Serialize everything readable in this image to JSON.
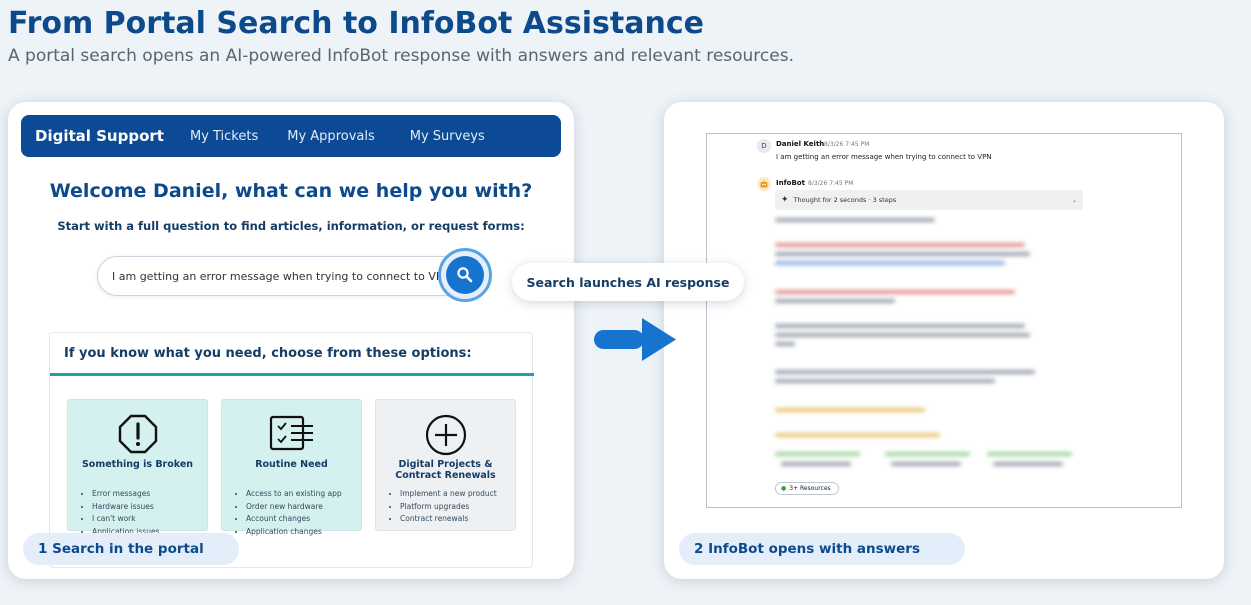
{
  "header": {
    "title": "From Portal Search to InfoBot Assistance",
    "subtitle": "A portal search opens an AI-powered InfoBot response with answers and relevant resources."
  },
  "portal": {
    "nav": {
      "brand": "Digital Support",
      "links": [
        "My Tickets",
        "My Approvals",
        "My Surveys"
      ]
    },
    "welcome": "Welcome Daniel, what can we help you with?",
    "prompt": "Start with a full question to find articles, information, or request forms:",
    "search": {
      "value": "I am getting an error message when trying to connect to VPN",
      "button_icon": "search-icon"
    },
    "options": {
      "title": "If you know what you need, choose from these options:",
      "cards": [
        {
          "title": "Something is Broken",
          "icon": "alert-octagon-icon",
          "items": [
            "Error messages",
            "Hardware issues",
            "I can't work",
            "Application issues"
          ]
        },
        {
          "title": "Routine Need",
          "icon": "checklist-icon",
          "items": [
            "Access to an existing app",
            "Order new hardware",
            "Account changes",
            "Application changes"
          ]
        },
        {
          "title": "Digital Projects & Contract Renewals",
          "icon": "plus-circle-icon",
          "items": [
            "Implement a new product",
            "Platform upgrades",
            "Contract renewals"
          ]
        }
      ]
    }
  },
  "steps": {
    "step1": "1  Search in the portal",
    "step2": "2  InfoBot opens with answers"
  },
  "callout": "Search launches AI response",
  "chat": {
    "user": {
      "avatar": "D",
      "name": "Daniel Keith",
      "time": "8/3/26 7:45 PM",
      "message": "I am getting an error message when trying to connect to VPN"
    },
    "bot": {
      "name": "InfoBot",
      "time": "8/3/26 7:45 PM",
      "thought": "Thought for 2 seconds · 3 steps"
    },
    "resources_badge": "3+ Resources"
  },
  "colors": {
    "brand": "#0d4a96",
    "accent": "#1674cf",
    "teal": "#1fa0a8"
  }
}
